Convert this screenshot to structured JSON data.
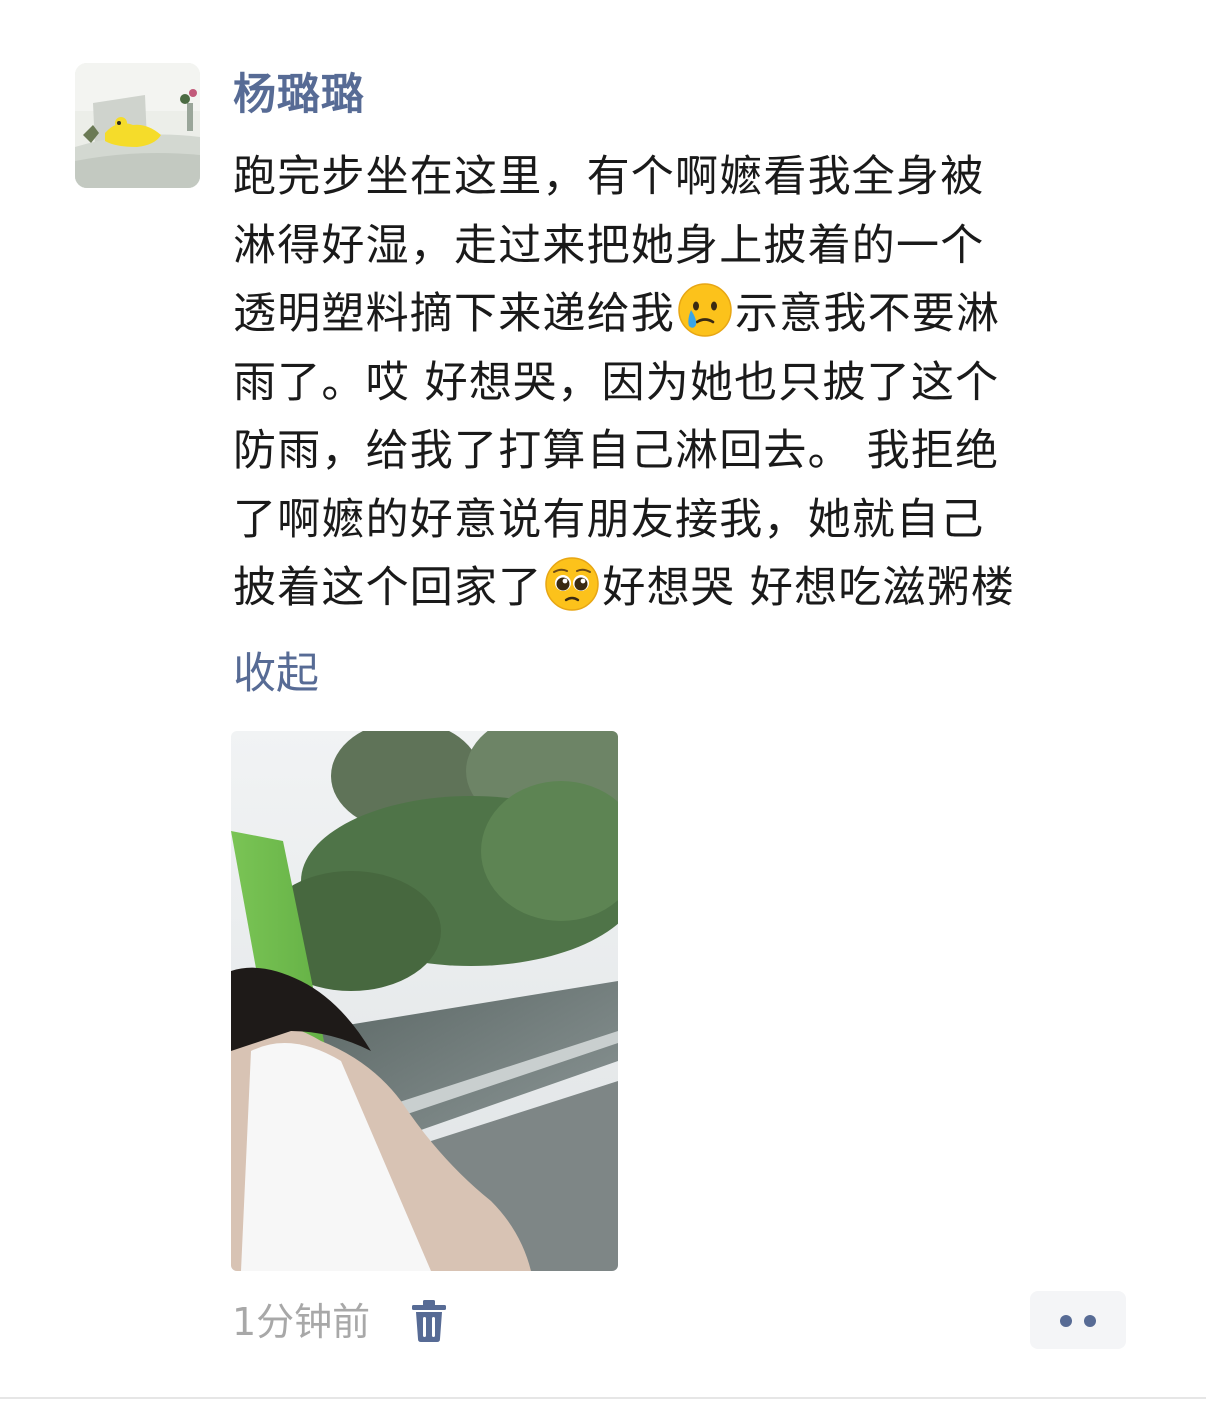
{
  "post": {
    "author": "杨璐璐",
    "content_lines": [
      {
        "text": "跑完步坐在这里，有个啊嬷看我全身被"
      },
      {
        "text": "淋得好湿，走过来把她身上披着的一个"
      },
      {
        "before": "透明塑料摘下来递给我",
        "emoji": "crying-face-emoji",
        "after": "示意我不要淋"
      },
      {
        "text": "雨了。哎 好想哭，因为她也只披了这个"
      },
      {
        "text": "防雨，给我了打算自己淋回去。 我拒绝"
      },
      {
        "text": "了啊嬷的好意说有朋友接我，她就自己"
      },
      {
        "before": "披着这个回家了",
        "emoji": "pleading-face-emoji",
        "after": "好想哭 好想吃滋粥楼"
      }
    ],
    "collapse_label": "收起",
    "timestamp": "1分钟前",
    "delete_icon": "trash-icon",
    "more_icon": "more-dots-icon"
  },
  "colors": {
    "link": "#576b95",
    "text": "#1a1a1a",
    "meta": "#a8a8a8",
    "more_button_bg": "#f4f5f7"
  }
}
